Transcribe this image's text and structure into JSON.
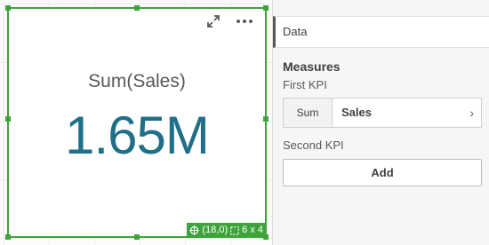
{
  "kpi": {
    "title": "Sum(Sales)",
    "value": "1.65M"
  },
  "status_badge": {
    "position_label": "(18,0)",
    "size_label": "6 x 4"
  },
  "panel": {
    "tab_label": "Data",
    "section_title": "Measures",
    "first_kpi": {
      "label": "First KPI",
      "aggregation": "Sum",
      "field": "Sales",
      "chevron": "›"
    },
    "second_kpi": {
      "label": "Second KPI",
      "add_label": "Add"
    }
  },
  "colors": {
    "selection": "#3fa33b",
    "kpi_value": "#1f6f89"
  },
  "icons": [
    "expand-icon",
    "more-options-icon",
    "position-icon",
    "size-icon",
    "chevron-right-icon"
  ]
}
